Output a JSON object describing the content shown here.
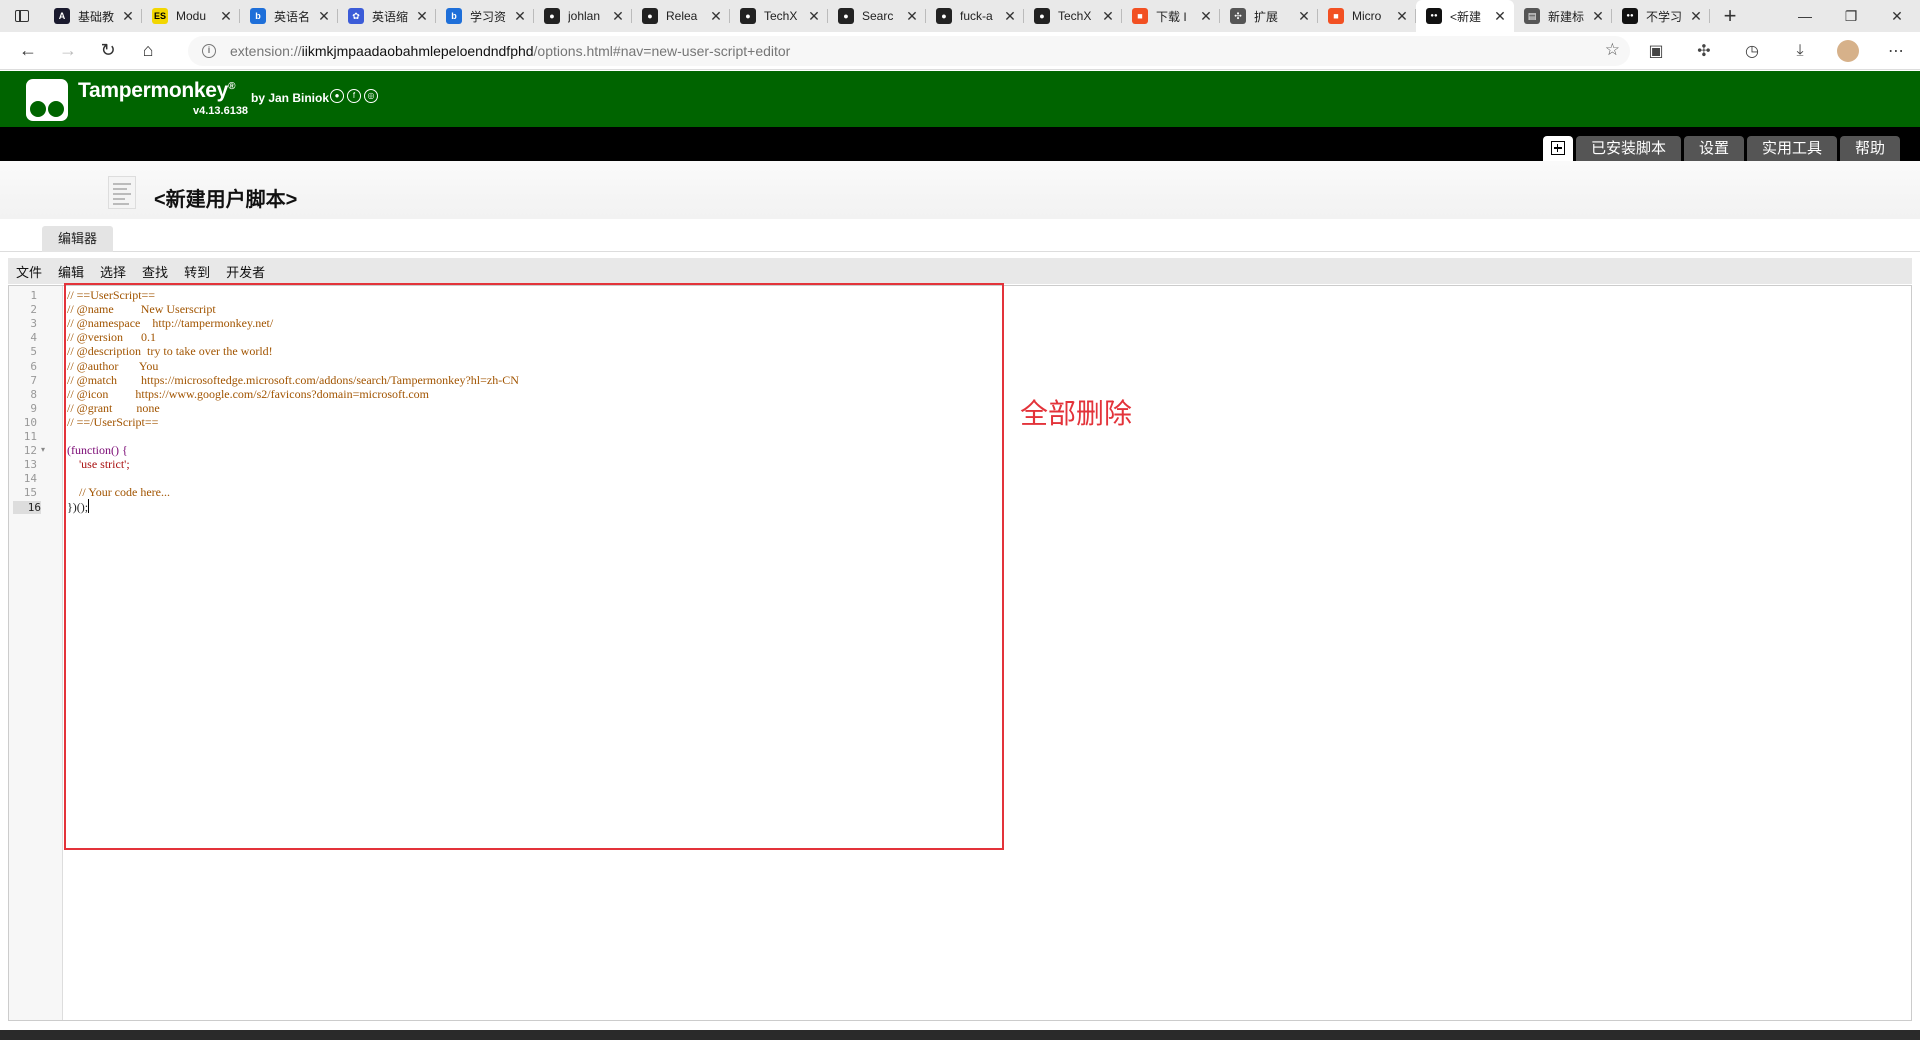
{
  "browser": {
    "tabs": [
      {
        "title": "基础教",
        "favicon": "A",
        "favicon_color": "#1a1a2e"
      },
      {
        "title": "Modu",
        "favicon": "ES",
        "favicon_color": "#f2d600"
      },
      {
        "title": "英语名",
        "favicon": "b",
        "favicon_color": "#1e6fd9"
      },
      {
        "title": "英语缩",
        "favicon": "✿",
        "favicon_color": "#3c5cd8"
      },
      {
        "title": "学习资",
        "favicon": "b",
        "favicon_color": "#1e6fd9"
      },
      {
        "title": "johlan",
        "favicon": "github",
        "favicon_color": "#222"
      },
      {
        "title": "Relea",
        "favicon": "github",
        "favicon_color": "#222"
      },
      {
        "title": "TechX",
        "favicon": "github",
        "favicon_color": "#222"
      },
      {
        "title": "Searc",
        "favicon": "github",
        "favicon_color": "#222"
      },
      {
        "title": "fuck-a",
        "favicon": "github",
        "favicon_color": "#222"
      },
      {
        "title": "TechX",
        "favicon": "github",
        "favicon_color": "#222"
      },
      {
        "title": "下载 I",
        "favicon": "ms",
        "favicon_color": "#f25022"
      },
      {
        "title": "扩展",
        "favicon": "puzzle",
        "favicon_color": "#555"
      },
      {
        "title": "Micro",
        "favicon": "ms",
        "favicon_color": "#f25022"
      },
      {
        "title": "<新建",
        "favicon": "tm",
        "favicon_color": "#111",
        "active": true
      },
      {
        "title": "新建标",
        "favicon": "page",
        "favicon_color": "#555"
      },
      {
        "title": "不学习",
        "favicon": "tm",
        "favicon_color": "#111"
      }
    ],
    "url_prefix": "extension://",
    "url_host": "iikmkjmpaadaobahmlepeloendndfphd",
    "url_path": "/options.html#nav=new-user-script+editor"
  },
  "app": {
    "name": "Tampermonkey",
    "reg": "®",
    "by": "by Jan Biniok",
    "version": "v4.13.6138",
    "nav_tabs": [
      "已安装脚本",
      "设置",
      "实用工具",
      "帮助"
    ]
  },
  "script": {
    "title": "<新建用户脚本>",
    "sub_tab": "编辑器"
  },
  "editor": {
    "menu": [
      "文件",
      "编辑",
      "选择",
      "查找",
      "转到",
      "开发者"
    ],
    "current_line": 16,
    "lines": [
      {
        "n": "1",
        "text": "// ==UserScript==",
        "cls": "c-comment"
      },
      {
        "n": "2",
        "text": "// @name         New Userscript",
        "cls": "c-comment"
      },
      {
        "n": "3",
        "text": "// @namespace    http://tampermonkey.net/",
        "cls": "c-comment"
      },
      {
        "n": "4",
        "text": "// @version      0.1",
        "cls": "c-comment"
      },
      {
        "n": "5",
        "text": "// @description  try to take over the world!",
        "cls": "c-comment"
      },
      {
        "n": "6",
        "text": "// @author       You",
        "cls": "c-comment"
      },
      {
        "n": "7",
        "text": "// @match        https://microsoftedge.microsoft.com/addons/search/Tampermonkey?hl=zh-CN",
        "cls": "c-comment"
      },
      {
        "n": "8",
        "text": "// @icon         https://www.google.com/s2/favicons?domain=microsoft.com",
        "cls": "c-comment"
      },
      {
        "n": "9",
        "text": "// @grant        none",
        "cls": "c-comment"
      },
      {
        "n": "10",
        "text": "// ==/UserScript==",
        "cls": "c-comment"
      },
      {
        "n": "11",
        "text": "",
        "cls": "c-plain"
      },
      {
        "n": "12",
        "text": "(function() {",
        "cls": "c-kw"
      },
      {
        "n": "13",
        "text": "    'use strict';",
        "cls": "c-str"
      },
      {
        "n": "14",
        "text": "",
        "cls": "c-plain"
      },
      {
        "n": "15",
        "text": "    // Your code here...",
        "cls": "c-comment"
      },
      {
        "n": "16",
        "text": "})();",
        "cls": "c-plain"
      }
    ]
  },
  "annotation": {
    "text": "全部删除",
    "color": "#e3333a"
  },
  "colors": {
    "header_green": "#006400",
    "nav_black": "#000000",
    "nav_tab_gray": "#555555"
  }
}
